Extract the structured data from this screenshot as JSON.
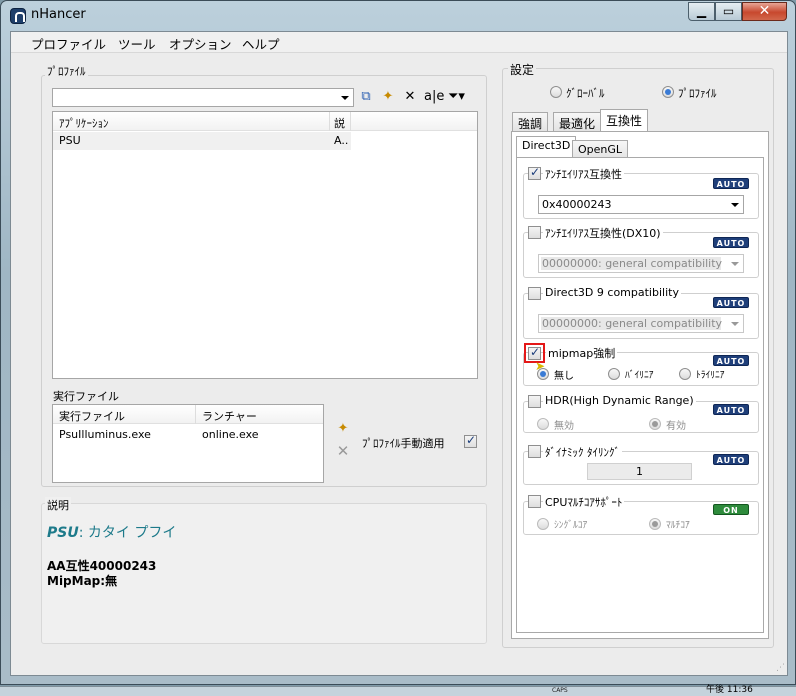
{
  "window": {
    "title": "nHancer"
  },
  "menu": [
    "プロファイル",
    "ツール",
    "オプション",
    "ヘルプ"
  ],
  "profile_group": {
    "label": "ﾌﾟﾛﾌｧｲﾙ",
    "combo_value": "",
    "toolbar_icons": [
      "copy-icon",
      "new-profile-icon",
      "delete-icon",
      "rename-icon",
      "filter-icon"
    ],
    "table": {
      "headers": [
        "ｱﾌﾟﾘｹｰｼｮﾝ",
        "説"
      ],
      "rows": [
        {
          "app": "PSU",
          "desc": "A.."
        }
      ]
    }
  },
  "exe_group": {
    "label": "実行ファイル",
    "headers": [
      "実行ファイル",
      "ランチャー"
    ],
    "rows": [
      {
        "exe": "PsuIlluminus.exe",
        "launcher": "online.exe"
      }
    ],
    "auto_apply_label": "ﾌﾟﾛﾌｧｲﾙ手動適用",
    "auto_apply_checked": true
  },
  "description": {
    "label": "説明",
    "game_name": "PSU",
    "game_sep": ":",
    "game_sub": " カタイ プフイ",
    "line1": "AA互性40000243",
    "line2": "MipMap:無"
  },
  "settings": {
    "label": "設定",
    "scope_global": "ｸﾞﾛｰﾊﾞﾙ",
    "scope_profile": "ﾌﾟﾛﾌｧｲﾙ",
    "tabs": [
      "強調",
      "最適化",
      "互換性"
    ],
    "subtabs": [
      "Direct3D",
      "OpenGL"
    ],
    "items": {
      "aa_compat": {
        "label": "ｱﾝﾁｴｲﾘｱｽ互換性",
        "badge": "AUTO",
        "checked": true,
        "value": "0x40000243"
      },
      "aa_dx10": {
        "label": "ｱﾝﾁｴｲﾘｱｽ互換性(DX10)",
        "badge": "AUTO",
        "checked": false,
        "value": "00000000: general compatibility"
      },
      "d3d9": {
        "label": "Direct3D 9 compatibility",
        "badge": "AUTO",
        "checked": false,
        "value": "00000000: general compatibility"
      },
      "mipmap": {
        "label": "mipmap強制",
        "badge": "AUTO",
        "checked": true,
        "options": [
          "無し",
          "ﾊﾞｲﾘﾆｱ",
          "ﾄﾗｲﾘﾆｱ"
        ]
      },
      "hdr": {
        "label": "HDR(High Dynamic Range)",
        "badge": "AUTO",
        "checked": false,
        "options": [
          "無効",
          "有効"
        ]
      },
      "tiling": {
        "label": "ﾀﾞｲﾅﾐｯｸ ﾀｲﾘﾝｸﾞ",
        "badge": "AUTO",
        "checked": false,
        "value": "1"
      },
      "cpu": {
        "label": "CPUﾏﾙﾁｺｱｻﾎﾟｰﾄ",
        "badge": "ON",
        "checked": false,
        "options": [
          "ｼﾝｸﾞﾙｺｱ",
          "ﾏﾙﾁｺｱ"
        ]
      }
    }
  },
  "taskbar": {
    "clock": "午後 11:36",
    "caps": "CAPS"
  }
}
